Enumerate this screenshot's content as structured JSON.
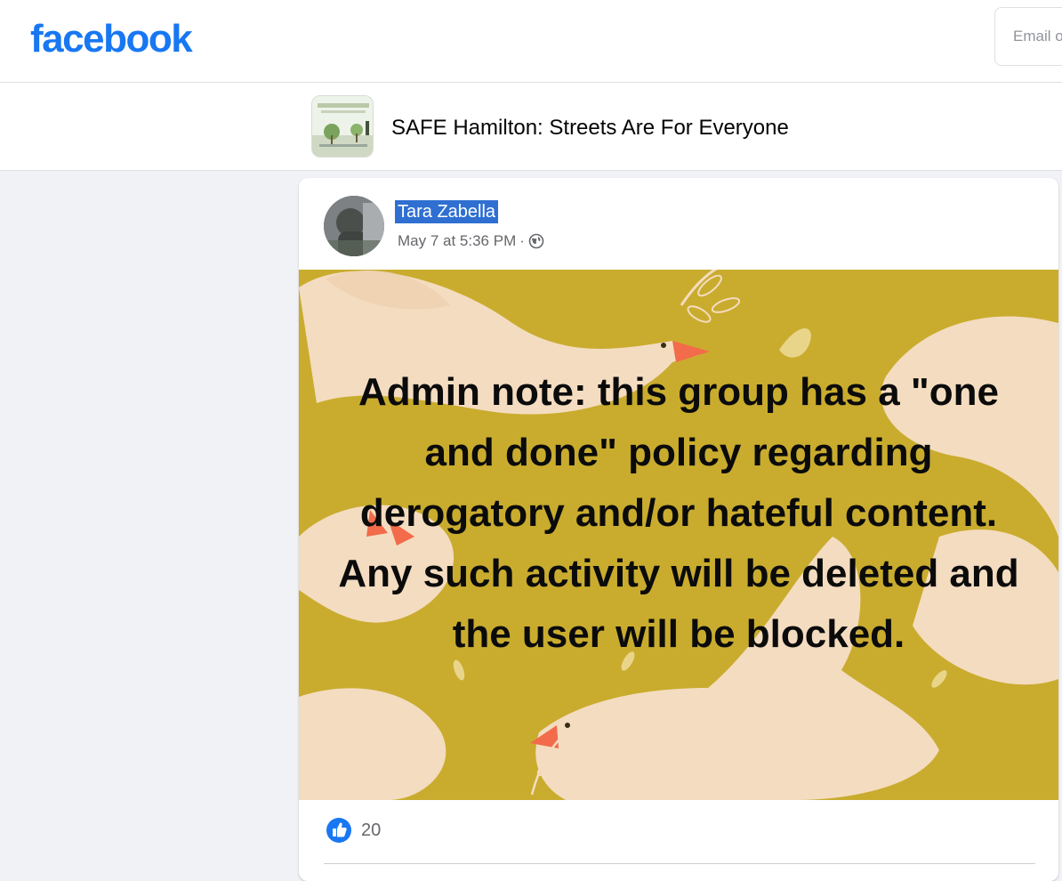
{
  "header": {
    "logo_text": "facebook",
    "email_placeholder": "Email or phone"
  },
  "group": {
    "name": "SAFE Hamilton: Streets Are For Everyone"
  },
  "post": {
    "author": "Tara Zabella",
    "timestamp": "May 7 at 5:36 PM",
    "separator": "·",
    "privacy_icon": "globe-icon",
    "image_text": "Admin note: this group has a \"one and done\" policy regarding derogatory and/or hateful content. Any such activity will be deleted and the user will be blocked.",
    "reactions": {
      "icon": "like-icon",
      "count": "20"
    }
  },
  "colors": {
    "brand": "#1877f2",
    "post_bg": "#c9ac2e",
    "dove": "#f4dcc0",
    "beak": "#f26b4a"
  }
}
